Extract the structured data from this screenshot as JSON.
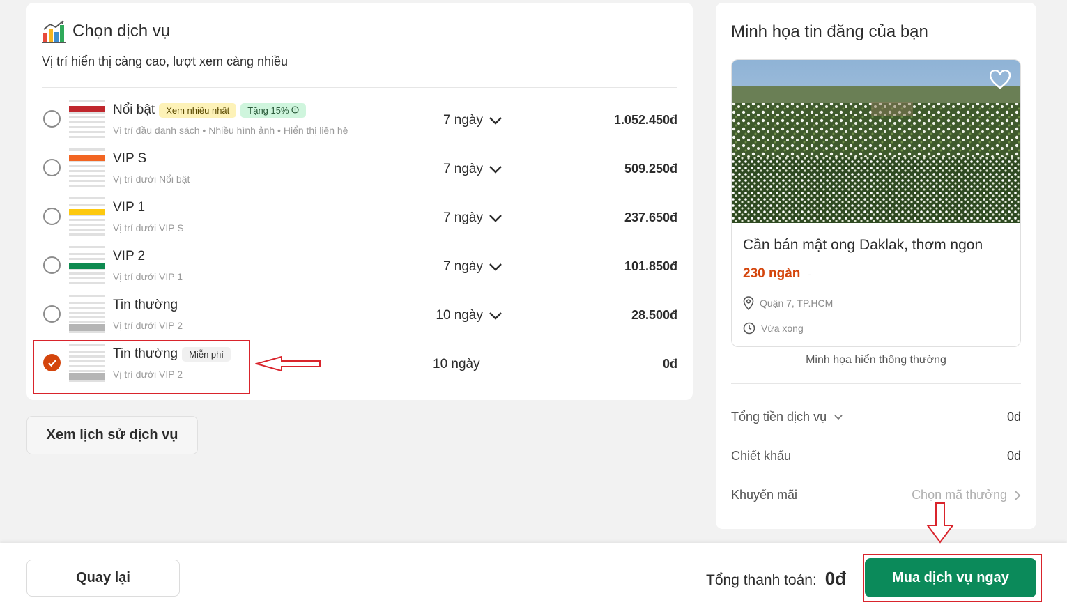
{
  "service": {
    "title": "Chọn dịch vụ",
    "subtitle": "Vị trí hiển thị càng cao, lượt xem càng nhiều",
    "options": [
      {
        "name": "Nổi bật",
        "badges": [
          "Xem nhiều nhất",
          "Tặng 15%"
        ],
        "desc": "Vị trí đầu danh sách • Nhiều hình ảnh • Hiển thị liên hệ",
        "days": "7 ngày",
        "price": "1.052.450đ",
        "selected": false,
        "color": "#c0272d"
      },
      {
        "name": "VIP S",
        "badges": [],
        "desc": "Vị trí dưới Nổi bật",
        "days": "7 ngày",
        "price": "509.250đ",
        "selected": false,
        "color": "#f26522"
      },
      {
        "name": "VIP 1",
        "badges": [],
        "desc": "Vị trí dưới VIP S",
        "days": "7 ngày",
        "price": "237.650đ",
        "selected": false,
        "color": "#fdc90f"
      },
      {
        "name": "VIP 2",
        "badges": [],
        "desc": "Vị trí dưới VIP 1",
        "days": "7 ngày",
        "price": "101.850đ",
        "selected": false,
        "color": "#0e8a50"
      },
      {
        "name": "Tin thường",
        "badges": [],
        "desc": "Vị trí dưới VIP 2",
        "days": "10 ngày",
        "price": "28.500đ",
        "selected": false,
        "color": "#b5b5b5"
      },
      {
        "name": "Tin thường",
        "badges": [
          "Miễn phí"
        ],
        "desc": "Vị trí dưới VIP 2",
        "days": "10 ngày",
        "price": "0đ",
        "selected": true,
        "color": "#b5b5b5"
      }
    ],
    "history_button": "Xem lịch sử dịch vụ"
  },
  "preview": {
    "title": "Minh họa tin đăng của bạn",
    "listing_title": "Cần bán mật ong Daklak, thơm ngon",
    "listing_price": "230 ngàn",
    "listing_price_sep": "-",
    "location": "Quận 7, TP.HCM",
    "time": "Vừa xong",
    "caption": "Minh họa hiển thông thường"
  },
  "summary": {
    "service_total_label": "Tổng tiền dịch vụ",
    "service_total_value": "0đ",
    "discount_label": "Chiết khấu",
    "discount_value": "0đ",
    "promo_label": "Khuyến mãi",
    "promo_action": "Chọn mã thưởng"
  },
  "footer": {
    "back_button": "Quay lại",
    "total_label": "Tổng thanh toán:",
    "total_value": "0đ",
    "buy_button": "Mua dịch vụ ngay"
  },
  "colors": {
    "accent": "#d4450c",
    "primary": "#0b8a5a",
    "annotation": "#d9242c"
  },
  "icons": [
    "chart-icon",
    "chevron-down-icon",
    "check-icon",
    "heart-icon",
    "location-pin-icon",
    "clock-icon",
    "chevron-right-icon",
    "info-icon"
  ]
}
